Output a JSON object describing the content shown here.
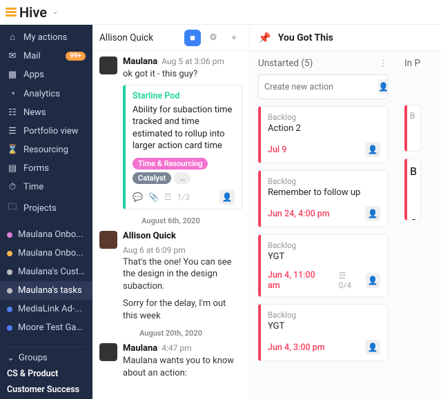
{
  "brand": {
    "name": "Hive"
  },
  "sidebar": {
    "nav": [
      {
        "icon": "home",
        "label": "My actions"
      },
      {
        "icon": "mail",
        "label": "Mail",
        "badge": "99+"
      },
      {
        "icon": "grid",
        "label": "Apps"
      },
      {
        "icon": "chart",
        "label": "Analytics"
      },
      {
        "icon": "news",
        "label": "News"
      },
      {
        "icon": "portfolio",
        "label": "Portfolio view"
      },
      {
        "icon": "resourcing",
        "label": "Resourcing"
      },
      {
        "icon": "forms",
        "label": "Forms"
      },
      {
        "icon": "time",
        "label": "Time"
      },
      {
        "icon": "folder",
        "label": "Projects"
      }
    ],
    "projects": [
      {
        "color": "#d97fd6",
        "label": "Maulana Onbo..."
      },
      {
        "color": "#f5b748",
        "label": "Maulana Onbo..."
      },
      {
        "color": "#bdbdbd",
        "label": "Maulana's Cust..."
      },
      {
        "color": "#bdbdbd",
        "label": "Maulana's tasks",
        "active": true
      },
      {
        "color": "#4f7ff0",
        "label": "MediaLink Ad-..."
      },
      {
        "color": "#4f7ff0",
        "label": "Moore Test Gantt"
      }
    ],
    "groups": {
      "toggle": "Groups",
      "items": [
        "CS & Product",
        "Customer Success"
      ]
    }
  },
  "conversation": {
    "title": "Allison Quick",
    "messages": [
      {
        "author": "Maulana",
        "time": "Aug 5 at 3:06 pm",
        "text": "ok got it - this guy?",
        "card": {
          "project": "Starline Pod",
          "title": "Ability for subaction time tracked and time estimated to rollup into larger action card time",
          "tags": [
            {
              "text": "Time & Resourcing",
              "color": "#f472d0"
            },
            {
              "text": "Catalyst",
              "color": "#7b8496"
            }
          ],
          "sub": "1/3"
        }
      },
      {
        "separator": "August 6th, 2020"
      },
      {
        "author": "Allison Quick",
        "time": "Aug 6 at 6:09 pm",
        "text": "That's the one! You can see the design in the design subaction.",
        "text2": "Sorry for the delay, I'm out this week"
      },
      {
        "separator": "August 20th, 2020"
      },
      {
        "author": "Maulana",
        "time": "4:47 pm",
        "text": "Maulana wants you to know about an action:"
      }
    ]
  },
  "board": {
    "title": "You Got This",
    "columns": [
      {
        "name": "Unstarted (5)",
        "newActionPlaceholder": "Create new action",
        "cards": [
          {
            "status": "Backlog",
            "title": "Action 2",
            "due": "Jul 9"
          },
          {
            "status": "Backlog",
            "title": "Remember to follow up",
            "due": "Jun 24, 4:00 pm"
          },
          {
            "status": "Backlog",
            "title": "YGT",
            "due": "Jun 4, 11:00 am",
            "sub": "0/4"
          },
          {
            "status": "Backlog",
            "title": "YGT",
            "due": "Jun 4, 3:00 pm"
          }
        ]
      },
      {
        "name": "In P",
        "peek": [
          {
            "status": "B"
          },
          {
            "status": "B",
            "sub": "C"
          }
        ]
      }
    ]
  },
  "icons": {
    "home": "⌂",
    "mail": "✉",
    "grid": "▦",
    "chart": "◔",
    "news": "☷",
    "portfolio": "☰",
    "resourcing": "⌛",
    "forms": "▤",
    "time": "⏱",
    "folder": "🗀",
    "chevronDown": "⌄",
    "video": "■",
    "gear": "⚙",
    "collapse": "«",
    "pin": "📌",
    "user": "👤",
    "comment": "💬",
    "attach": "📎",
    "list": "☲",
    "dots": "⋮"
  }
}
